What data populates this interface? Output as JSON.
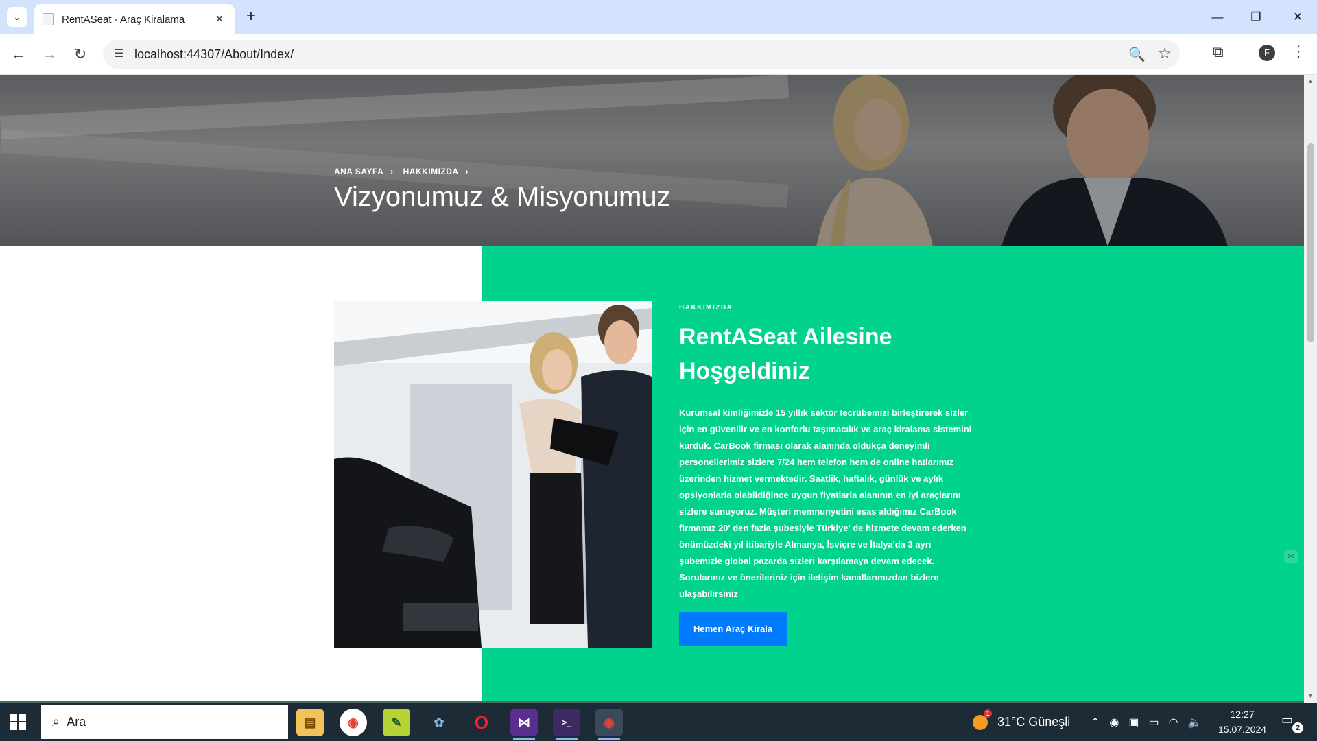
{
  "browser": {
    "tab_title": "RentASeat - Araç Kiralama",
    "url": "localhost:44307/About/Index/",
    "profile_initial": "F"
  },
  "hero": {
    "breadcrumb": [
      "ANA SAYFA",
      "HAKKIMIZDA"
    ],
    "title": "Vizyonumuz & Misyonumuz"
  },
  "about": {
    "subheading": "HAKKIMIZDA",
    "heading_line1": "RentASeat Ailesine",
    "heading_line2": "Hoşgeldiniz",
    "body": "Kurumsal kimliğimizle 15 yıllık sektör tecrübemizi birleştirerek sizler için en güvenilir ve en konforlu taşımacılık ve araç kiralama sistemini kurduk. CarBook firması olarak alanında oldukça deneyimli personellerimiz sizlere 7/24 hem telefon hem de online hatlarımız üzerinden hizmet vermektedir. Saatlik, haftalık, günlük ve aylık opsiyonlarla olabildiğince uygun fiyatlarla alanının en iyi araçlarını sizlere sunuyoruz. Müşteri memnunyetini esas aldığımız CarBook firmamız 20' den fazla şubesiyle Türkiye' de hizmete devam ederken önümüzdeki yıl itibariyle Almanya, İsviçre ve İtalya'da 3 ayrı şubemizle global pazarda sizleri karşılamaya devam edecek. Sorularınız ve önerileriniz için iletişim kanallarımızdan bizlere ulaşabilirsiniz",
    "cta_label": "Hemen Araç Kirala"
  },
  "taskbar": {
    "search_placeholder": "Ara",
    "weather": "31°C  Güneşli",
    "time": "12:27",
    "date": "15.07.2024",
    "notification_count": "2"
  },
  "colors": {
    "accent_green": "#01d28e",
    "cta_blue": "#007bff",
    "tabstrip": "#d3e3fd"
  }
}
